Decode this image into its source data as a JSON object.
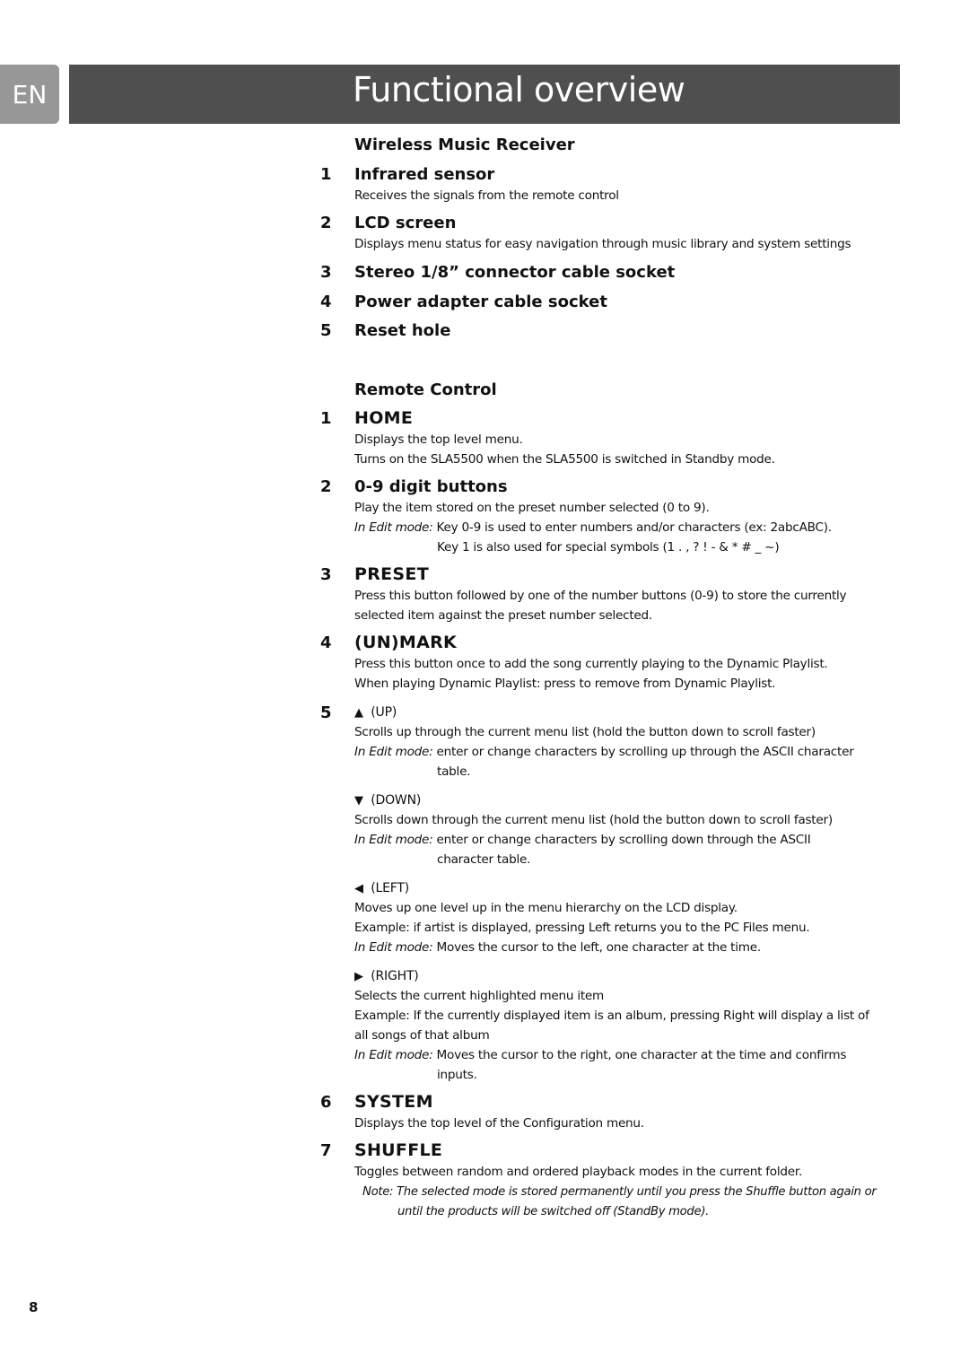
{
  "header": {
    "lang": "EN",
    "title": "Functional overview"
  },
  "receiver": {
    "heading": "Wireless Music Receiver",
    "items": [
      {
        "num": "1",
        "title": "Infrared sensor",
        "desc": "Receives the signals from the remote control"
      },
      {
        "num": "2",
        "title": "LCD screen",
        "desc": "Displays menu status for easy navigation through music library and system settings"
      },
      {
        "num": "3",
        "title": "Stereo 1/8” connector cable socket"
      },
      {
        "num": "4",
        "title": "Power adapter cable socket"
      },
      {
        "num": "5",
        "title": "Reset hole"
      }
    ]
  },
  "remote": {
    "heading": "Remote Control",
    "home": {
      "num": "1",
      "title": "HOME",
      "lines": [
        "Displays the top level menu.",
        "Turns on the SLA5500 when the SLA5500 is switched in Standby mode."
      ]
    },
    "digits": {
      "num": "2",
      "title": "0-9 digit buttons",
      "line1": "Play the item stored on the preset number selected (0 to 9).",
      "edit_label": "In Edit mode:",
      "edit1": " Key 0-9 is used to enter numbers and/or characters (ex: 2abcABC).",
      "edit2": "Key 1 is also used for special symbols (1 . , ? ! - & * # _ ~)"
    },
    "preset": {
      "num": "3",
      "title": "PRESET",
      "lines": [
        "Press this button followed by one of the number buttons (0-9) to store the currently",
        "selected item against the preset number selected."
      ]
    },
    "unmark": {
      "num": "4",
      "title": "(UN)MARK",
      "lines": [
        "Press this button once to add the song currently playing to the Dynamic Playlist.",
        "When playing Dynamic Playlist: press to remove from Dynamic Playlist."
      ]
    },
    "nav": {
      "num": "5",
      "up": {
        "icon": "▲",
        "label": "(UP)",
        "line1": "Scrolls up through the current menu list (hold the button down to scroll faster)",
        "edit_label": "In Edit mode:",
        "edit1": " enter or change characters by scrolling up through the ASCII character",
        "edit2": "table."
      },
      "down": {
        "icon": "▼",
        "label": "(DOWN)",
        "line1": "Scrolls down through the current menu list (hold the button down to scroll faster)",
        "edit_label": "In Edit mode:",
        "edit1": " enter or change characters by scrolling down through the ASCII",
        "edit2": "character table."
      },
      "left": {
        "icon": "◀",
        "label": "(LEFT)",
        "line1": "Moves up one level up in the menu hierarchy on the LCD display.",
        "line2": "Example: if artist is displayed, pressing Left returns you to the PC Files menu.",
        "edit_label": "In Edit mode:",
        "edit1": " Moves the cursor to the left, one character at the time."
      },
      "right": {
        "icon": "▶",
        "label": "(RIGHT)",
        "line1": "Selects the current highlighted menu item",
        "line2": "Example: If the currently displayed item is an album, pressing Right will display a list of",
        "line3": "all songs of that album",
        "edit_label": "In Edit mode:",
        "edit1": " Moves the cursor to the right, one character at the time and confirms",
        "edit2": "inputs."
      }
    },
    "system": {
      "num": "6",
      "title": "SYSTEM",
      "desc": "Displays the top level of the Configuration menu."
    },
    "shuffle": {
      "num": "7",
      "title": "SHUFFLE",
      "desc": "Toggles between random and ordered playback modes in the current folder.",
      "note1": "Note: The selected mode is stored permanently until you press the Shuffle button again or",
      "note2": "until the products will be switched off (StandBy mode)."
    }
  },
  "footer": {
    "page_number": "8"
  }
}
